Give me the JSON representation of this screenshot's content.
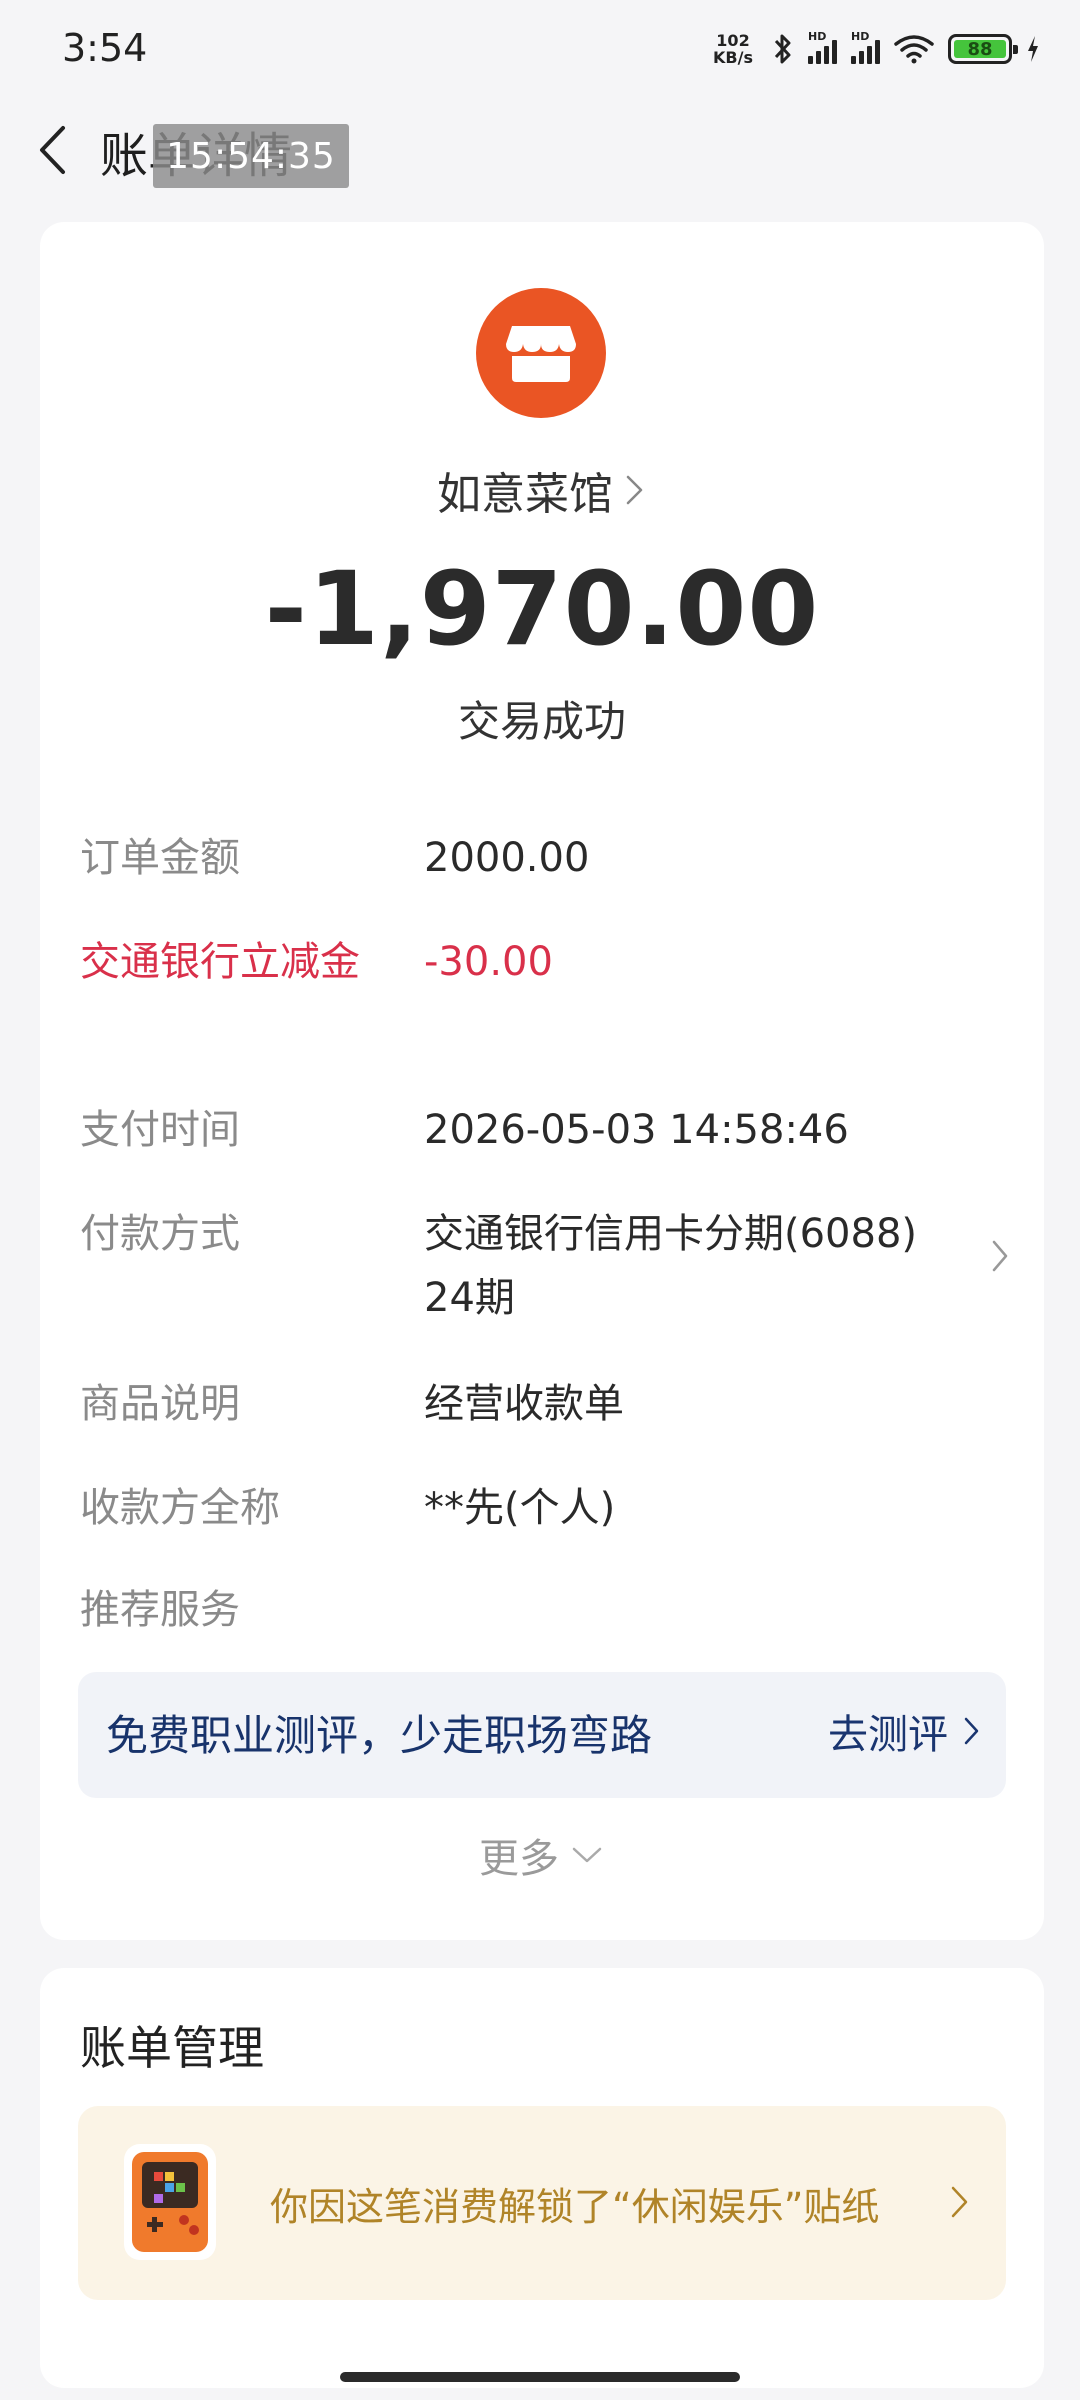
{
  "status_bar": {
    "time": "3:54",
    "net_speed_value": "102",
    "net_speed_unit": "KB/s",
    "signal_label": "HD",
    "battery_level": "88",
    "colors": {
      "battery": "#45c43c"
    }
  },
  "header": {
    "back_icon": "chevron-left-icon",
    "title": "账单详情",
    "time_overlay": "15:54:35"
  },
  "merchant": {
    "icon": "store-icon",
    "name": "如意菜馆",
    "amount": "-1,970.00",
    "status": "交易成功",
    "colors": {
      "logo": "#ea5524"
    }
  },
  "details": [
    {
      "label": "订单金额",
      "value": "2000.00"
    },
    {
      "label": "交通银行立减金",
      "value": "-30.00"
    },
    {
      "label": "支付时间",
      "value": "2026-05-03 14:58:46"
    },
    {
      "label": "付款方式",
      "value": "交通银行信用卡分期(6088) 24期"
    },
    {
      "label": "商品说明",
      "value": "经营收款单"
    },
    {
      "label": "收款方全称",
      "value": "**先(个人)"
    },
    {
      "label": "推荐服务",
      "value": ""
    }
  ],
  "promo": {
    "text": "免费职业测评，少走职场弯路",
    "action": "去测评"
  },
  "more_label": "更多",
  "bill_management": {
    "title": "账单管理",
    "sticker_text": "你因这笔消费解锁了“休闲娱乐”贴纸",
    "sticker_icon": "game-console-sticker-icon"
  },
  "accent_colors": {
    "discount_red": "#d9304a",
    "promo_blue": "#18336b",
    "sticker_gold": "#b08428"
  }
}
